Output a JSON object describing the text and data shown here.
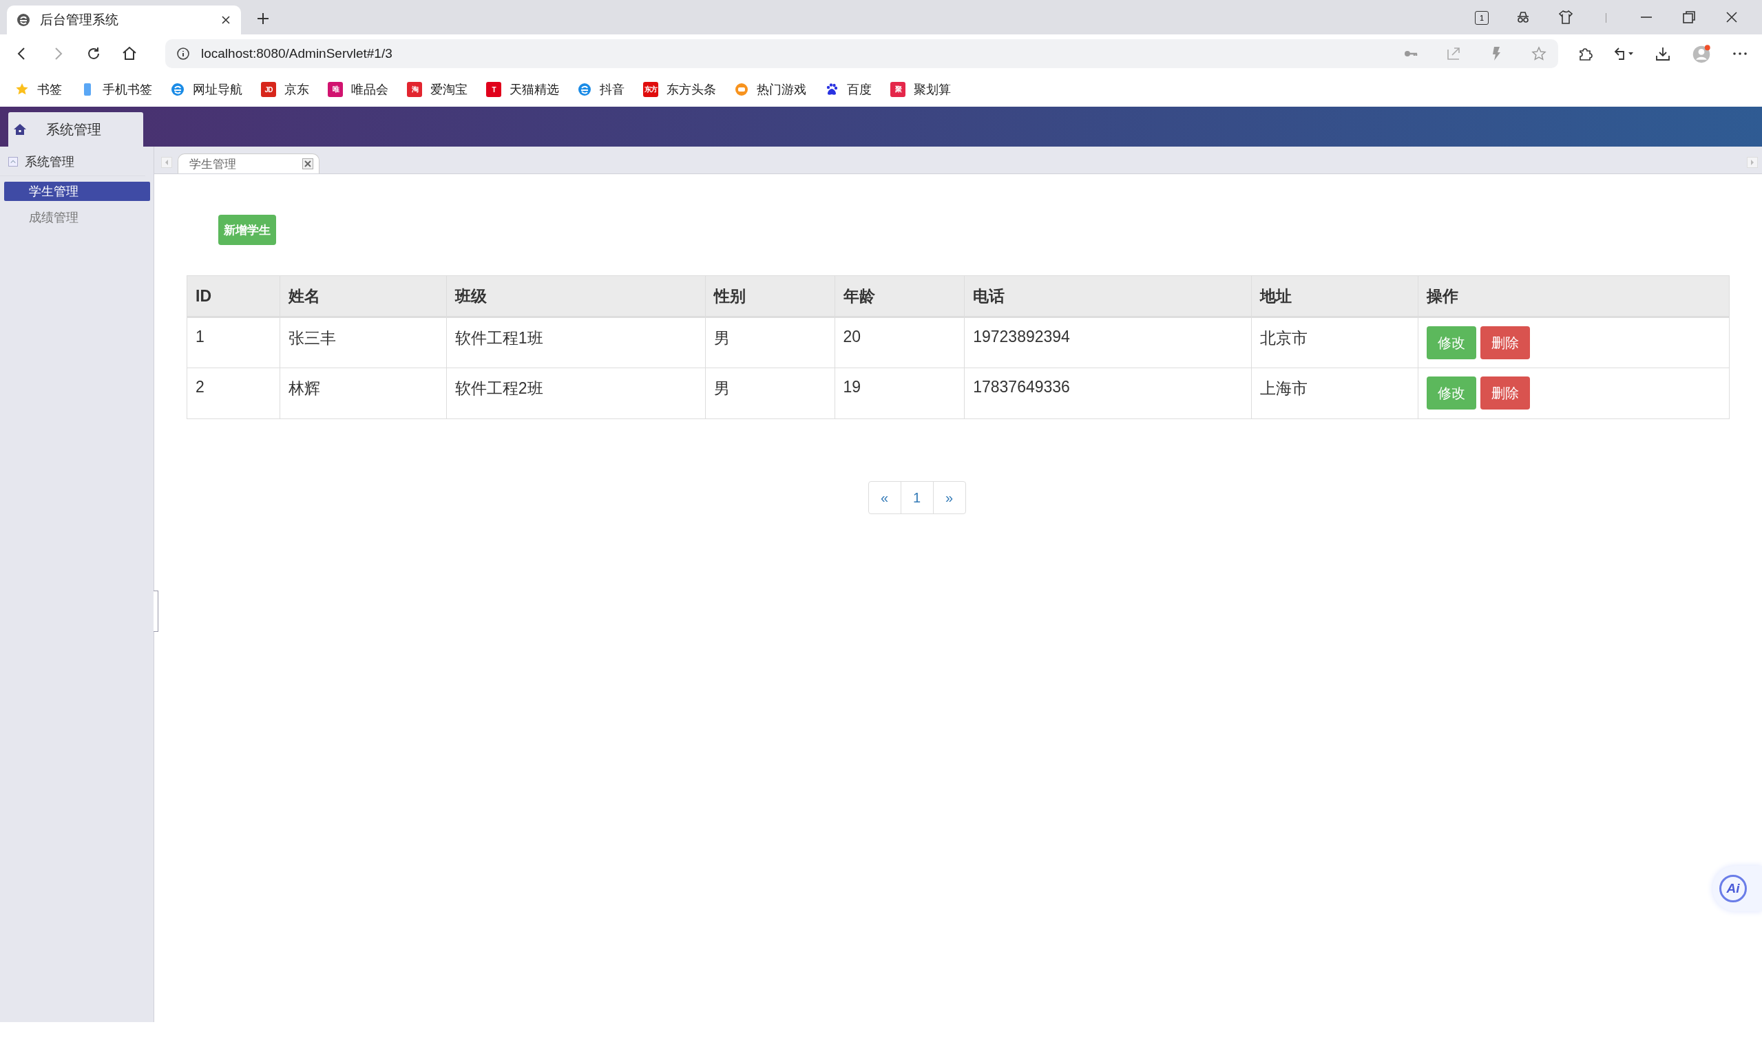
{
  "browser": {
    "tab_title": "后台管理系统",
    "tab_count": "1",
    "address": "localhost:8080/AdminServlet#1/3",
    "bookmarks": [
      {
        "label": "书签",
        "kind": "star"
      },
      {
        "label": "手机书签",
        "kind": "phone"
      },
      {
        "label": "网址导航",
        "kind": "edge"
      },
      {
        "label": "京东",
        "kind": "badge",
        "icon_text": "JD",
        "color": "#d7261b"
      },
      {
        "label": "唯品会",
        "kind": "badge",
        "icon_text": "唯",
        "color": "#d1136f"
      },
      {
        "label": "爱淘宝",
        "kind": "badge",
        "icon_text": "淘",
        "color": "#e2252f"
      },
      {
        "label": "天猫精选",
        "kind": "badge",
        "icon_text": "T",
        "color": "#e0001b"
      },
      {
        "label": "抖音",
        "kind": "edge"
      },
      {
        "label": "东方头条",
        "kind": "badge",
        "icon_text": "东方",
        "color": "#e00d0d"
      },
      {
        "label": "热门游戏",
        "kind": "game"
      },
      {
        "label": "百度",
        "kind": "paw"
      },
      {
        "label": "聚划算",
        "kind": "badge",
        "icon_text": "聚",
        "color": "#e4274a"
      }
    ]
  },
  "header": {
    "tab": "系统管理"
  },
  "sidebar": {
    "group": "系统管理",
    "expanded": true,
    "items": [
      {
        "label": "学生管理",
        "selected": true
      },
      {
        "label": "成绩管理",
        "selected": false
      }
    ]
  },
  "tabs": [
    {
      "label": "学生管理",
      "selected": true
    }
  ],
  "add_button": "新增学生",
  "table": {
    "columns": [
      "ID",
      "姓名",
      "班级",
      "性别",
      "年龄",
      "电话",
      "地址",
      "操作"
    ],
    "rows": [
      {
        "cells": [
          "1",
          "张三丰",
          "软件工程1班",
          "男",
          "20",
          "19723892394",
          "北京市"
        ],
        "actions": [
          "修改",
          "删除"
        ]
      },
      {
        "cells": [
          "2",
          "林辉",
          "软件工程2班",
          "男",
          "19",
          "17837649336",
          "上海市"
        ],
        "actions": [
          "修改",
          "删除"
        ]
      }
    ]
  },
  "pagination": {
    "prev": "«",
    "pages": [
      "1"
    ],
    "next": "»"
  },
  "assistant_badge": "Ai"
}
